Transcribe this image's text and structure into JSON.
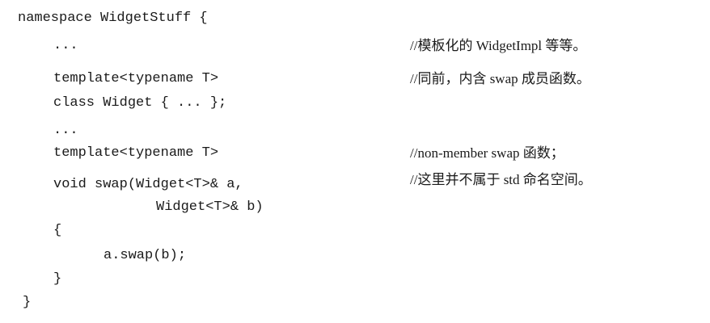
{
  "code": {
    "lines": [
      "namespace WidgetStuff {",
      "...",
      "template<typename T>",
      "class Widget { ... };",
      "...",
      "template<typename T>",
      "void swap(Widget<T>& a,",
      "Widget<T>& b)",
      "{",
      "a.swap(b);",
      "}",
      "}"
    ]
  },
  "comments": [
    "//模板化的 WidgetImpl 等等。",
    "//同前，内含 swap 成员函数。",
    "//non-member swap 函数；",
    "//这里并不属于 std 命名空间。"
  ]
}
